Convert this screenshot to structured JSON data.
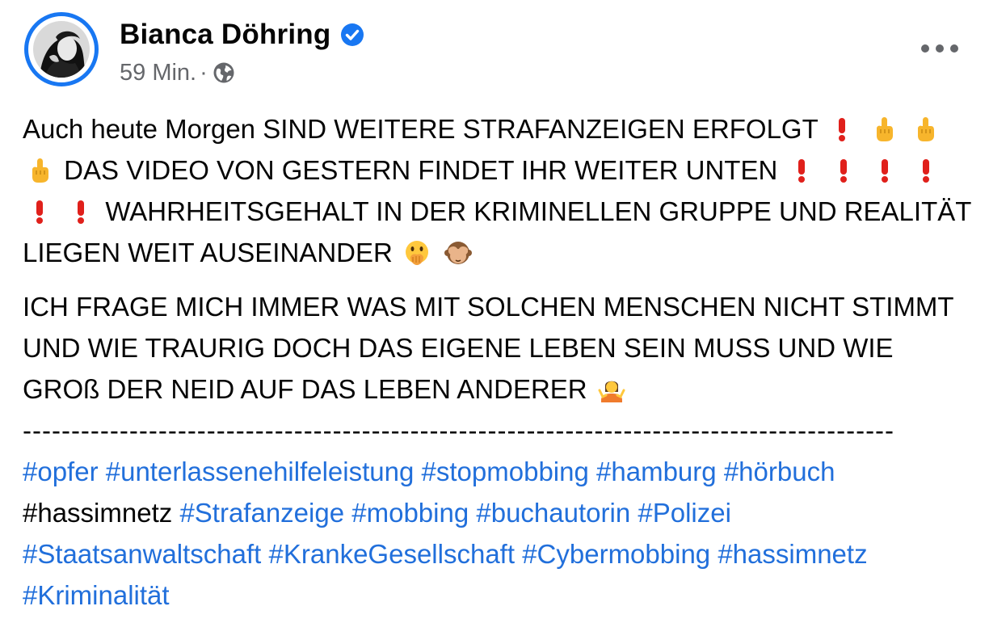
{
  "post": {
    "author": "Bianca Döhring",
    "time": "59 Min.",
    "separator": "·",
    "audience_icon": "globe-icon",
    "verified_icon": "verified-badge-icon",
    "more_icon": "more-options-icon"
  },
  "content": {
    "p1": {
      "t1": "Auch heute Morgen SIND WEITERE STRAFANZEIGEN ERFOLGT",
      "t2": "DAS VIDEO VON GESTERN FINDET IHR WEITER UNTEN",
      "t3": "WAHRHEITSGEHALT IN DER KRIMINELLEN GRUPPE UND REALITÄT LIEGEN WEIT AUSEINANDER"
    },
    "p2": {
      "t1": "ICH FRAGE MICH IMMER WAS MIT SOLCHEN MENSCHEN NICHT STIMMT UND WIE TRAURIG DOCH DAS EIGENE LEBEN SEIN MUSS UND WIE GROß DER NEID AUF DAS LEBEN ANDERER"
    },
    "divider": "------------------------------------------------------------------------------------------",
    "hashtags": {
      "h1": "#opfer",
      "h2": "#unterlassenehilfeleistung",
      "h3": "#stopmobbing",
      "h4": "#hamburg",
      "h5": "#hörbuch",
      "h6": "#hassimnetz",
      "h7": "#Strafanzeige",
      "h8": "#mobbing",
      "h9": "#buchautorin",
      "h10": "#Polizei",
      "h11": "#Staatsanwaltschaft",
      "h12": "#KrankeGesellschaft",
      "h13": "#Cybermobbing",
      "h14": "#hassimnetz",
      "h15": "#Kriminalität"
    }
  },
  "colors": {
    "link": "#216fdb",
    "text": "#050505",
    "secondary": "#65676b",
    "accent": "#1877f2"
  }
}
